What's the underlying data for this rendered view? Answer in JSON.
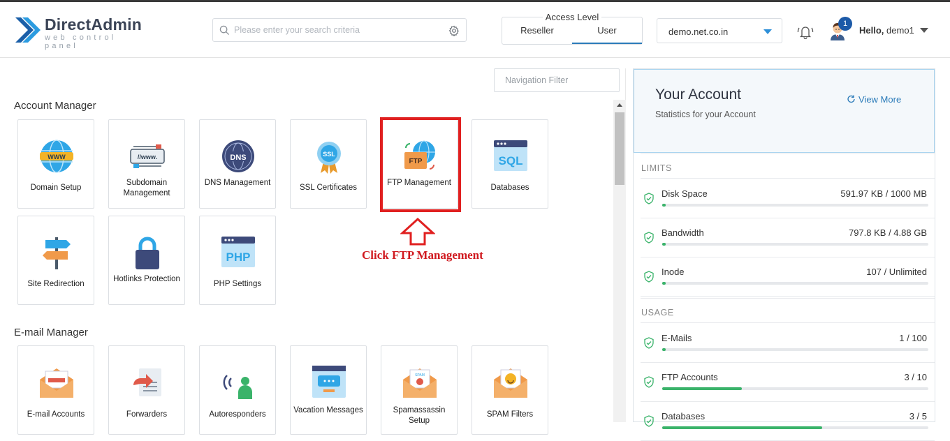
{
  "app": {
    "name": "DirectAdmin",
    "tagline": "web control panel"
  },
  "header": {
    "search_placeholder": "Please enter your search criteria",
    "access_level": {
      "title": "Access Level",
      "options": [
        "Reseller",
        "User"
      ],
      "selected": "User"
    },
    "domain": "demo.net.co.in",
    "notifications": "1",
    "greeting": "Hello,",
    "username": "demo1"
  },
  "nav_filter_placeholder": "Navigation Filter",
  "sections": [
    {
      "title": "Account Manager",
      "items": [
        {
          "label": "Domain Setup",
          "icon": "www-globe-icon"
        },
        {
          "label": "Subdomain Management",
          "icon": "subdomain-icon"
        },
        {
          "label": "DNS Management",
          "icon": "dns-icon"
        },
        {
          "label": "SSL Certificates",
          "icon": "ssl-icon"
        },
        {
          "label": "FTP Management",
          "icon": "ftp-icon"
        },
        {
          "label": "Databases",
          "icon": "sql-icon"
        },
        {
          "label": "Site Redirection",
          "icon": "signpost-icon"
        },
        {
          "label": "Hotlinks Protection",
          "icon": "padlock-icon"
        },
        {
          "label": "PHP Settings",
          "icon": "php-icon"
        }
      ]
    },
    {
      "title": "E-mail Manager",
      "items": [
        {
          "label": "E-mail Accounts",
          "icon": "email-accounts-icon"
        },
        {
          "label": "Forwarders",
          "icon": "forwarders-icon"
        },
        {
          "label": "Autoresponders",
          "icon": "autoresponder-icon"
        },
        {
          "label": "Vacation Messages",
          "icon": "vacation-message-icon"
        },
        {
          "label": "Spamassassin Setup",
          "icon": "spam-envelope-icon"
        },
        {
          "label": "SPAM Filters",
          "icon": "spam-filter-icon"
        }
      ]
    }
  ],
  "annotation": {
    "text": "Click FTP Management",
    "color": "#d0191f"
  },
  "account_panel": {
    "title": "Your Account",
    "subtitle": "Statistics for your Account",
    "view_more": "View More",
    "limits_label": "LIMITS",
    "usage_label": "USAGE",
    "limits": [
      {
        "name": "Disk Space",
        "value": "591.97 KB / 1000 MB",
        "fraction": 0.006
      },
      {
        "name": "Bandwidth",
        "value": "797.8 KB / 4.88 GB",
        "fraction": 0.002
      },
      {
        "name": "Inode",
        "value": "107 / Unlimited",
        "fraction": 0.0
      }
    ],
    "usage": [
      {
        "name": "E-Mails",
        "value": "1 / 100",
        "fraction": 0.01
      },
      {
        "name": "FTP Accounts",
        "value": "3 / 10",
        "fraction": 0.3
      },
      {
        "name": "Databases",
        "value": "3 / 5",
        "fraction": 0.6
      }
    ]
  },
  "colors": {
    "accent": "#2b7bb9",
    "progress": "#3ab36a",
    "highlight": "#e02020"
  }
}
